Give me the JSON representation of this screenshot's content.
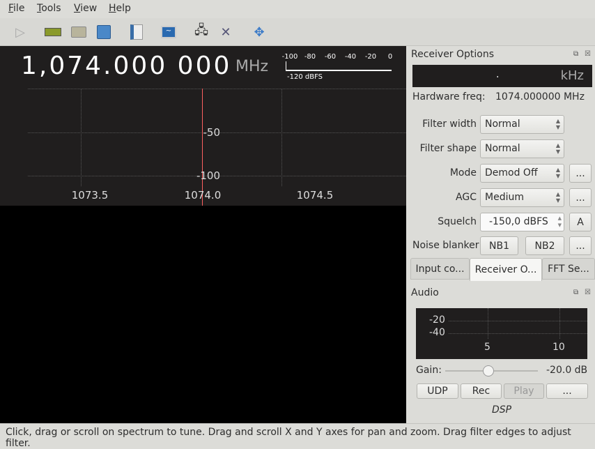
{
  "menu": [
    "File",
    "Tools",
    "View",
    "Help"
  ],
  "toolbar": [
    "play-icon",
    "hardware-icon",
    "open-folder-icon",
    "save-icon",
    "bookmark-icon",
    "monitor-icon",
    "network-icon",
    "tools-icon",
    "fit-icon"
  ],
  "spectrum": {
    "frequency": "1,074.000 000",
    "unit": "MHz",
    "y_ticks": [
      "-50",
      "-100"
    ],
    "x_ticks": [
      "1073.5",
      "1074.0",
      "1074.5"
    ],
    "meter_ticks": [
      "-100",
      "-80",
      "-60",
      "-40",
      "-20",
      "0"
    ],
    "meter_value": "-120 dBFS",
    "marker_color": "#ff6060"
  },
  "receiver": {
    "title": "Receiver Options",
    "offset_dot": ".",
    "offset_unit": "kHz",
    "hw_label": "Hardware freq:",
    "hw_value": "1074.000000 MHz",
    "filter_width_label": "Filter width",
    "filter_width": "Normal",
    "filter_shape_label": "Filter shape",
    "filter_shape": "Normal",
    "mode_label": "Mode",
    "mode": "Demod Off",
    "agc_label": "AGC",
    "agc": "Medium",
    "squelch_label": "Squelch",
    "squelch": "-150,0 dBFS",
    "squelch_auto": "A",
    "nb_label": "Noise blanker",
    "nb1": "NB1",
    "nb2": "NB2",
    "more": "..."
  },
  "tabs": [
    "Input co...",
    "Receiver O...",
    "FFT Se..."
  ],
  "audio": {
    "title": "Audio",
    "y_ticks": [
      "-20",
      "-40"
    ],
    "x_ticks": [
      "5",
      "10"
    ],
    "gain_label": "Gain:",
    "gain_value": "-20.0 dB",
    "gain_fraction": 0.5,
    "udp": "UDP",
    "rec": "Rec",
    "play": "Play",
    "more": "...",
    "dsp": "DSP"
  },
  "status": "Click, drag or scroll on spectrum to tune. Drag and scroll X and Y axes for pan and zoom. Drag filter edges to adjust filter."
}
